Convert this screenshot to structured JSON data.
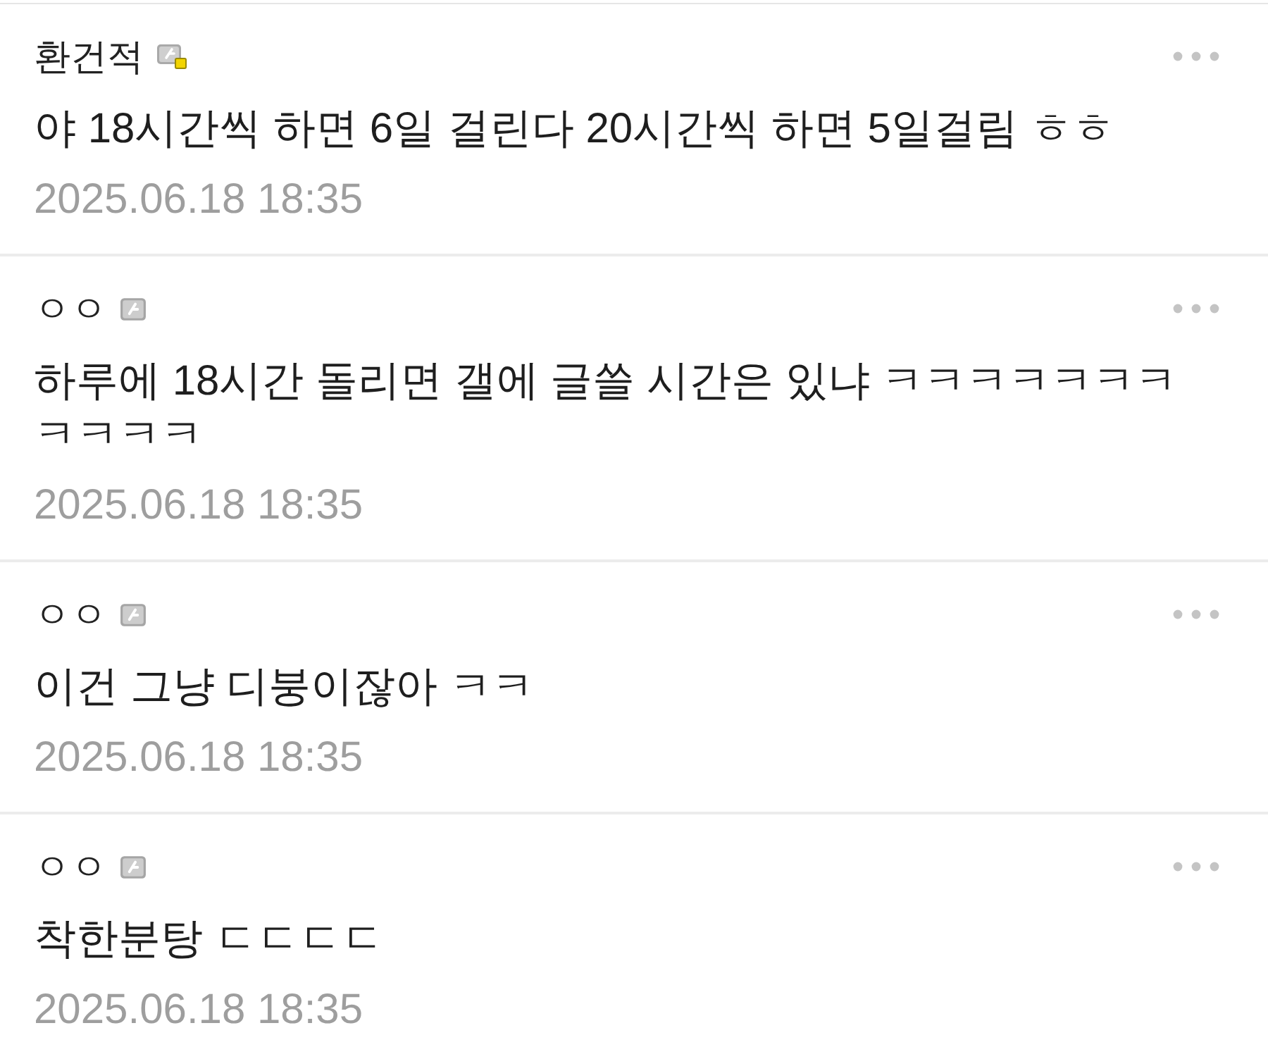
{
  "comments": [
    {
      "author": "환건적",
      "kind": "fixed",
      "text": "야 18시간씩 하면 6일 걸린다 20시간씩 하면 5일걸림 ㅎㅎ",
      "date": "2025.06.18 18:35"
    },
    {
      "author": "ㅇㅇ",
      "kind": "floating",
      "text": "하루에 18시간 돌리면 갤에 글쓸 시간은 있냐 ㅋㅋㅋㅋㅋㅋㅋㅋㅋㅋㅋ",
      "date": "2025.06.18 18:35"
    },
    {
      "author": "ㅇㅇ",
      "kind": "floating",
      "text": "이건 그냥 디붕이잖아 ㅋㅋ",
      "date": "2025.06.18 18:35"
    },
    {
      "author": "ㅇㅇ",
      "kind": "floating",
      "text": "착한분탕 ㄷㄷㄷㄷ",
      "date": "2025.06.18 18:35"
    }
  ]
}
